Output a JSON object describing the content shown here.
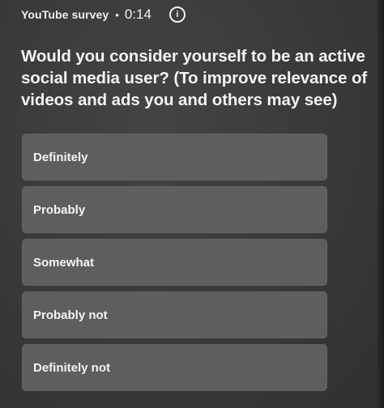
{
  "header": {
    "survey_label": "YouTube survey",
    "separator": "•",
    "timer": "0:14",
    "info_icon": "info-icon"
  },
  "question": "Would you consider yourself to be an active social media user? (To improve relevance of videos and ads you and others may see)",
  "options": [
    {
      "label": "Definitely"
    },
    {
      "label": "Probably"
    },
    {
      "label": "Somewhat"
    },
    {
      "label": "Probably not"
    },
    {
      "label": "Definitely not"
    }
  ],
  "colors": {
    "background": "#3a3b3a",
    "option_background": "#5d5e5d",
    "text": "#f3f3f3"
  }
}
